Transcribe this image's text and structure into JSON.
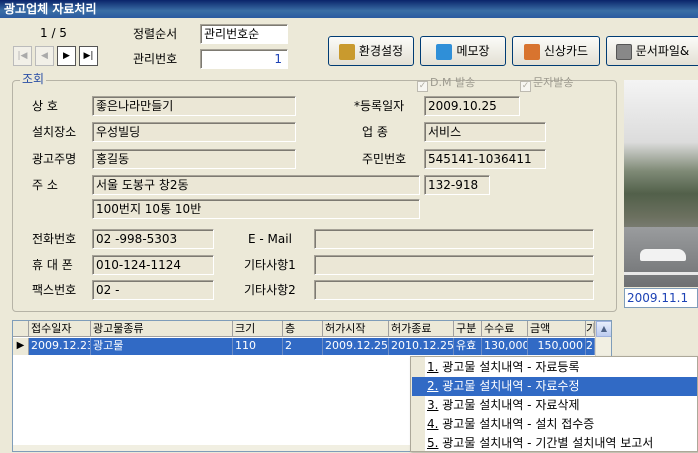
{
  "window": {
    "title": "광고업체 자료처리"
  },
  "nav": {
    "record_position": "1 / 5",
    "first": "|◀",
    "prev": "◀",
    "next": "▶",
    "last": "▶|"
  },
  "sort": {
    "label": "정렬순서",
    "value": "관리번호순"
  },
  "id": {
    "label": "관리번호",
    "value": "1"
  },
  "toolbar": {
    "settings_label": "환경설정",
    "memo_label": "메모장",
    "credit_label": "신상카드",
    "document_label": "문서파일&"
  },
  "form": {
    "group_title": "조회",
    "dm_label": "D.M 발송",
    "sms_label": "문자발송",
    "company_label": "상    호",
    "company_value": "좋은나라만들기",
    "regdate_label": "*등록일자",
    "regdate_value": "2009.10.25",
    "location_label": "설치장소",
    "location_value": "우성빌딩",
    "biztype_label": "업    종",
    "biztype_value": "서비스",
    "owner_label": "광고주명",
    "owner_value": "홍길동",
    "rrn_label": "주민번호",
    "rrn_value": "545141-1036411",
    "address_label": "주    소",
    "address1_value": "서울 도봉구 창2동",
    "zipcode_value": "132-918",
    "address2_value": "100번지 10통 10반",
    "phone_label": "전화번호",
    "phone_value": "02   -998-5303",
    "email_label": "E - Mail",
    "email_value": "",
    "mobile_label": "휴 대 폰",
    "mobile_value": "010-124-1124",
    "etc1_label": "기타사항1",
    "etc1_value": "",
    "fax_label": "팩스번호",
    "fax_value": "02   -",
    "etc2_label": "기타사항2",
    "etc2_value": ""
  },
  "photo": {
    "date_text": "2009.11.1"
  },
  "grid": {
    "columns": [
      "접수일자",
      "광고물종류",
      "크기",
      "층",
      "허가시작",
      "허가종료",
      "구분",
      "수수료",
      "금액",
      "기"
    ],
    "rows": [
      [
        "2009.12.23",
        "광고물",
        "110",
        "2",
        "2009.12.25",
        "2010.12.25",
        "유효",
        "130,000",
        "150,000",
        "2"
      ]
    ]
  },
  "menu": {
    "items": [
      {
        "num": "1.",
        "text": " 광고물 설치내역 - 자료등록"
      },
      {
        "num": "2.",
        "text": " 광고물 설치내역 - 자료수정"
      },
      {
        "num": "3.",
        "text": " 광고물 설치내역 - 자료삭제"
      },
      {
        "num": "4.",
        "text": " 광고물 설치내역 - 설치 접수증"
      },
      {
        "num": "5.",
        "text": " 광고물 설치내역 - 기간별 설치내역 보고서"
      }
    ],
    "selected_index": 1
  },
  "colors": {
    "accent": "#316ac5",
    "title_bar": "#0a246a",
    "window_bg": "#ece9d8",
    "group_title": "#2a4fa5"
  }
}
